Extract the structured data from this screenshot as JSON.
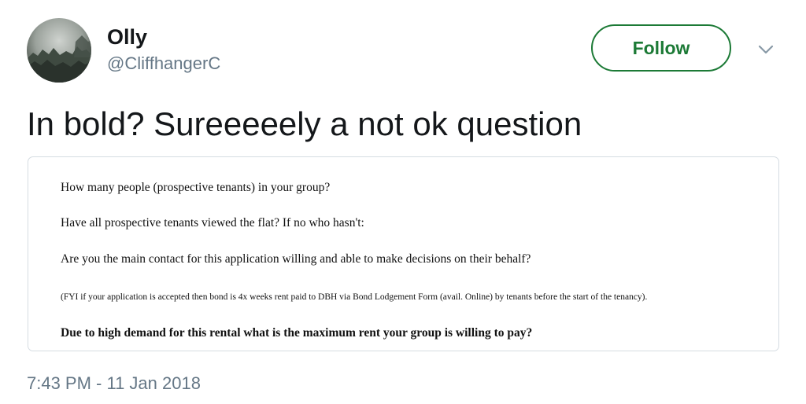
{
  "tweet": {
    "author": {
      "name": "Olly",
      "handle": "@CliffhangerC",
      "avatar_icon": "misty-trees-avatar"
    },
    "follow_label": "Follow",
    "menu_icon": "chevron-down-icon",
    "text": "In bold? Sureeeeely a not ok question",
    "timestamp": "7:43 PM - 11 Jan 2018"
  },
  "attached_image": {
    "questions": [
      "How many people (prospective tenants) in your group?",
      "Have all prospective tenants viewed the flat? If no who hasn't:",
      "Are you the main contact for this application willing and able to make decisions on their behalf?",
      "(FYI if your application is accepted then bond is 4x weeks rent paid to DBH via Bond Lodgement Form (avail. Online) by tenants before the start of the tenancy).",
      "Due to high demand for this rental what is the maximum rent your group is willing to pay?"
    ]
  },
  "colors": {
    "follow_accent": "#1c7a36",
    "secondary_text": "#657786",
    "primary_text": "#14171a",
    "card_border": "#d5dce2"
  }
}
